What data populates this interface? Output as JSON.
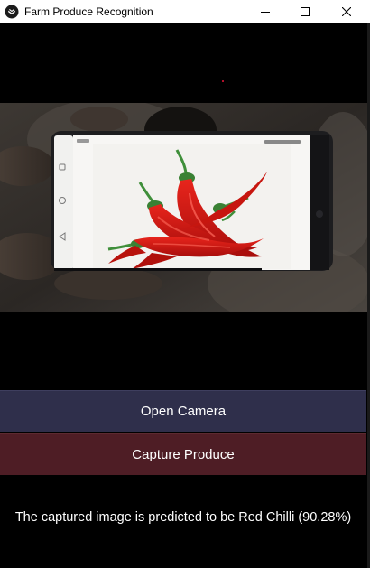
{
  "window": {
    "title": "Farm Produce Recognition",
    "controls": {
      "minimize_icon": "minimize-icon",
      "maximize_icon": "maximize-icon",
      "close_icon": "close-icon"
    }
  },
  "camera": {
    "preview_subject": "phone-showing-red-chillies"
  },
  "buttons": {
    "open_camera": "Open Camera",
    "capture_produce": "Capture Produce"
  },
  "result": {
    "text": "The captured image is predicted to be Red Chilli (90.28%)",
    "label": "Red Chilli",
    "confidence_percent": 90.28
  },
  "colors": {
    "window_background": "#000000",
    "titlebar_background": "#ffffff",
    "open_camera_button": "#2f2f4b",
    "capture_button": "#4e1d25",
    "text": "#ffffff"
  }
}
